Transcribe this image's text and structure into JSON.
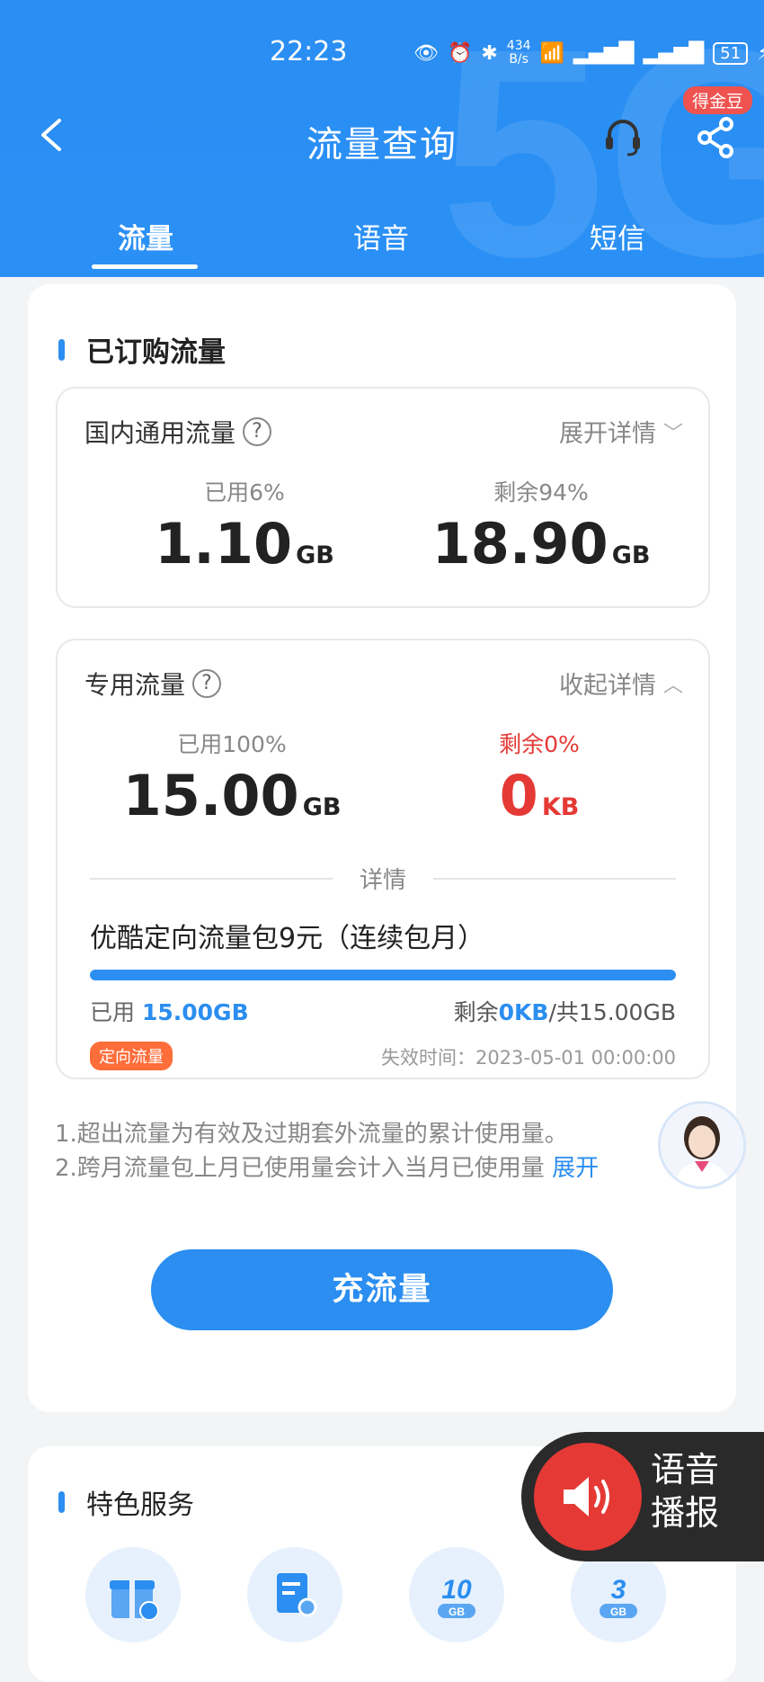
{
  "status_bar": {
    "time": "22:23",
    "net_speed_value": "434",
    "net_speed_unit": "B/s",
    "battery": "51"
  },
  "nav": {
    "title": "流量查询",
    "gold_badge": "得金豆"
  },
  "tabs": [
    {
      "label": "流量"
    },
    {
      "label": "语音"
    },
    {
      "label": "短信"
    }
  ],
  "subscribed": {
    "title": "已订购流量",
    "domestic": {
      "title": "国内通用流量",
      "help": "?",
      "toggle": "展开详情",
      "used_label": "已用6%",
      "used_value": "1.10",
      "used_unit": "GB",
      "remain_label": "剩余94%",
      "remain_value": "18.90",
      "remain_unit": "GB"
    },
    "special": {
      "title": "专用流量",
      "help": "?",
      "toggle": "收起详情",
      "used_label": "已用100%",
      "used_value": "15.00",
      "used_unit": "GB",
      "remain_label": "剩余0%",
      "remain_value": "0",
      "remain_unit": "KB",
      "detail_label": "详情",
      "package_name": "优酷定向流量包9元（连续包月）",
      "progress": 1.0,
      "used_prefix": "已用",
      "used_amount": "15.00GB",
      "remain_prefix": "剩余",
      "remain_amount": "0KB",
      "total_text": "/共15.00GB",
      "tag": "定向流量",
      "expire_text": "失效时间：2023-05-01 00:00:00"
    }
  },
  "notes": {
    "line1": "1.超出流量为有效及过期套外流量的累计使用量。",
    "line2": "2.跨月流量包上月已使用量会计入当月已使用量",
    "expand": "展开"
  },
  "recharge_button": "充流量",
  "services": {
    "title": "特色服务",
    "items": [
      {
        "icon": "gift-icon"
      },
      {
        "icon": "bill-search-icon"
      },
      {
        "icon": "10gb-icon",
        "text": "10",
        "unit": "GB"
      },
      {
        "icon": "3gb-icon",
        "text": "3",
        "unit": "GB"
      }
    ]
  },
  "voice_broadcast": {
    "line1": "语音",
    "line2": "播报"
  },
  "colors": {
    "brand_blue": "#2b8ef0",
    "red": "#e53935",
    "orange_tag": "#ff6d3a"
  }
}
